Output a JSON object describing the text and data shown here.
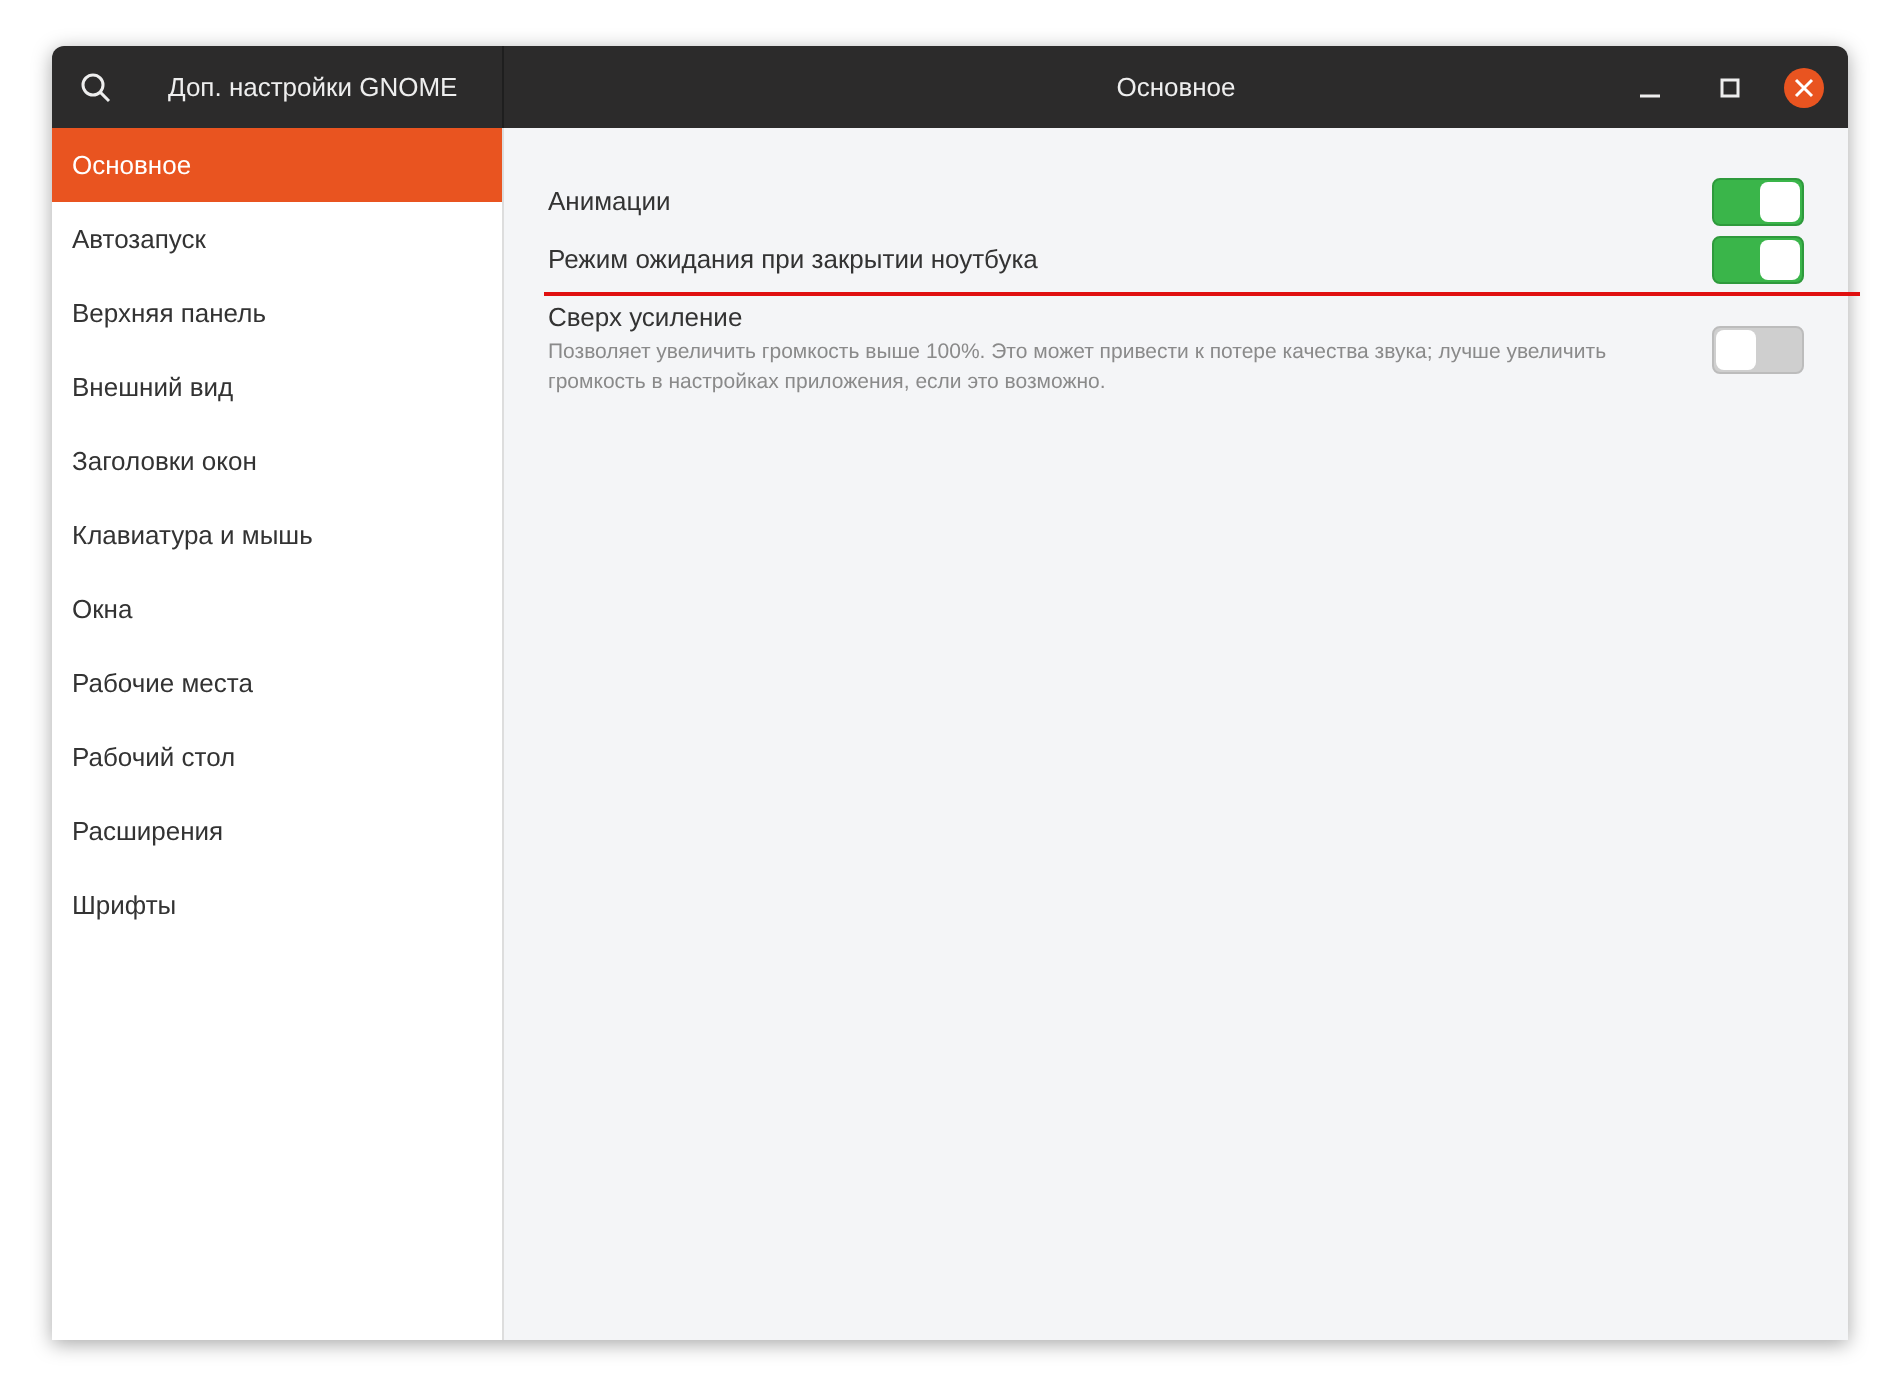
{
  "window": {
    "app_title": "Доп. настройки GNOME",
    "title": "Основное"
  },
  "sidebar": {
    "items": [
      {
        "label": "Основное",
        "selected": true
      },
      {
        "label": "Автозапуск",
        "selected": false
      },
      {
        "label": "Верхняя панель",
        "selected": false
      },
      {
        "label": "Внешний вид",
        "selected": false
      },
      {
        "label": "Заголовки окон",
        "selected": false
      },
      {
        "label": "Клавиатура и мышь",
        "selected": false
      },
      {
        "label": "Окна",
        "selected": false
      },
      {
        "label": "Рабочие места",
        "selected": false
      },
      {
        "label": "Рабочий стол",
        "selected": false
      },
      {
        "label": "Расширения",
        "selected": false
      },
      {
        "label": "Шрифты",
        "selected": false
      }
    ]
  },
  "settings": [
    {
      "label": "Анимации",
      "on": true,
      "underlined": false
    },
    {
      "label": "Режим ожидания при закрытии ноутбука",
      "on": true,
      "underlined": true
    },
    {
      "label": "Сверх усиление",
      "description": "Позволяет увеличить громкость выше 100%. Это может привести к потере качества звука; лучше увеличить громкость в настройках приложения, если это возможно.",
      "on": false,
      "underlined": false
    }
  ]
}
